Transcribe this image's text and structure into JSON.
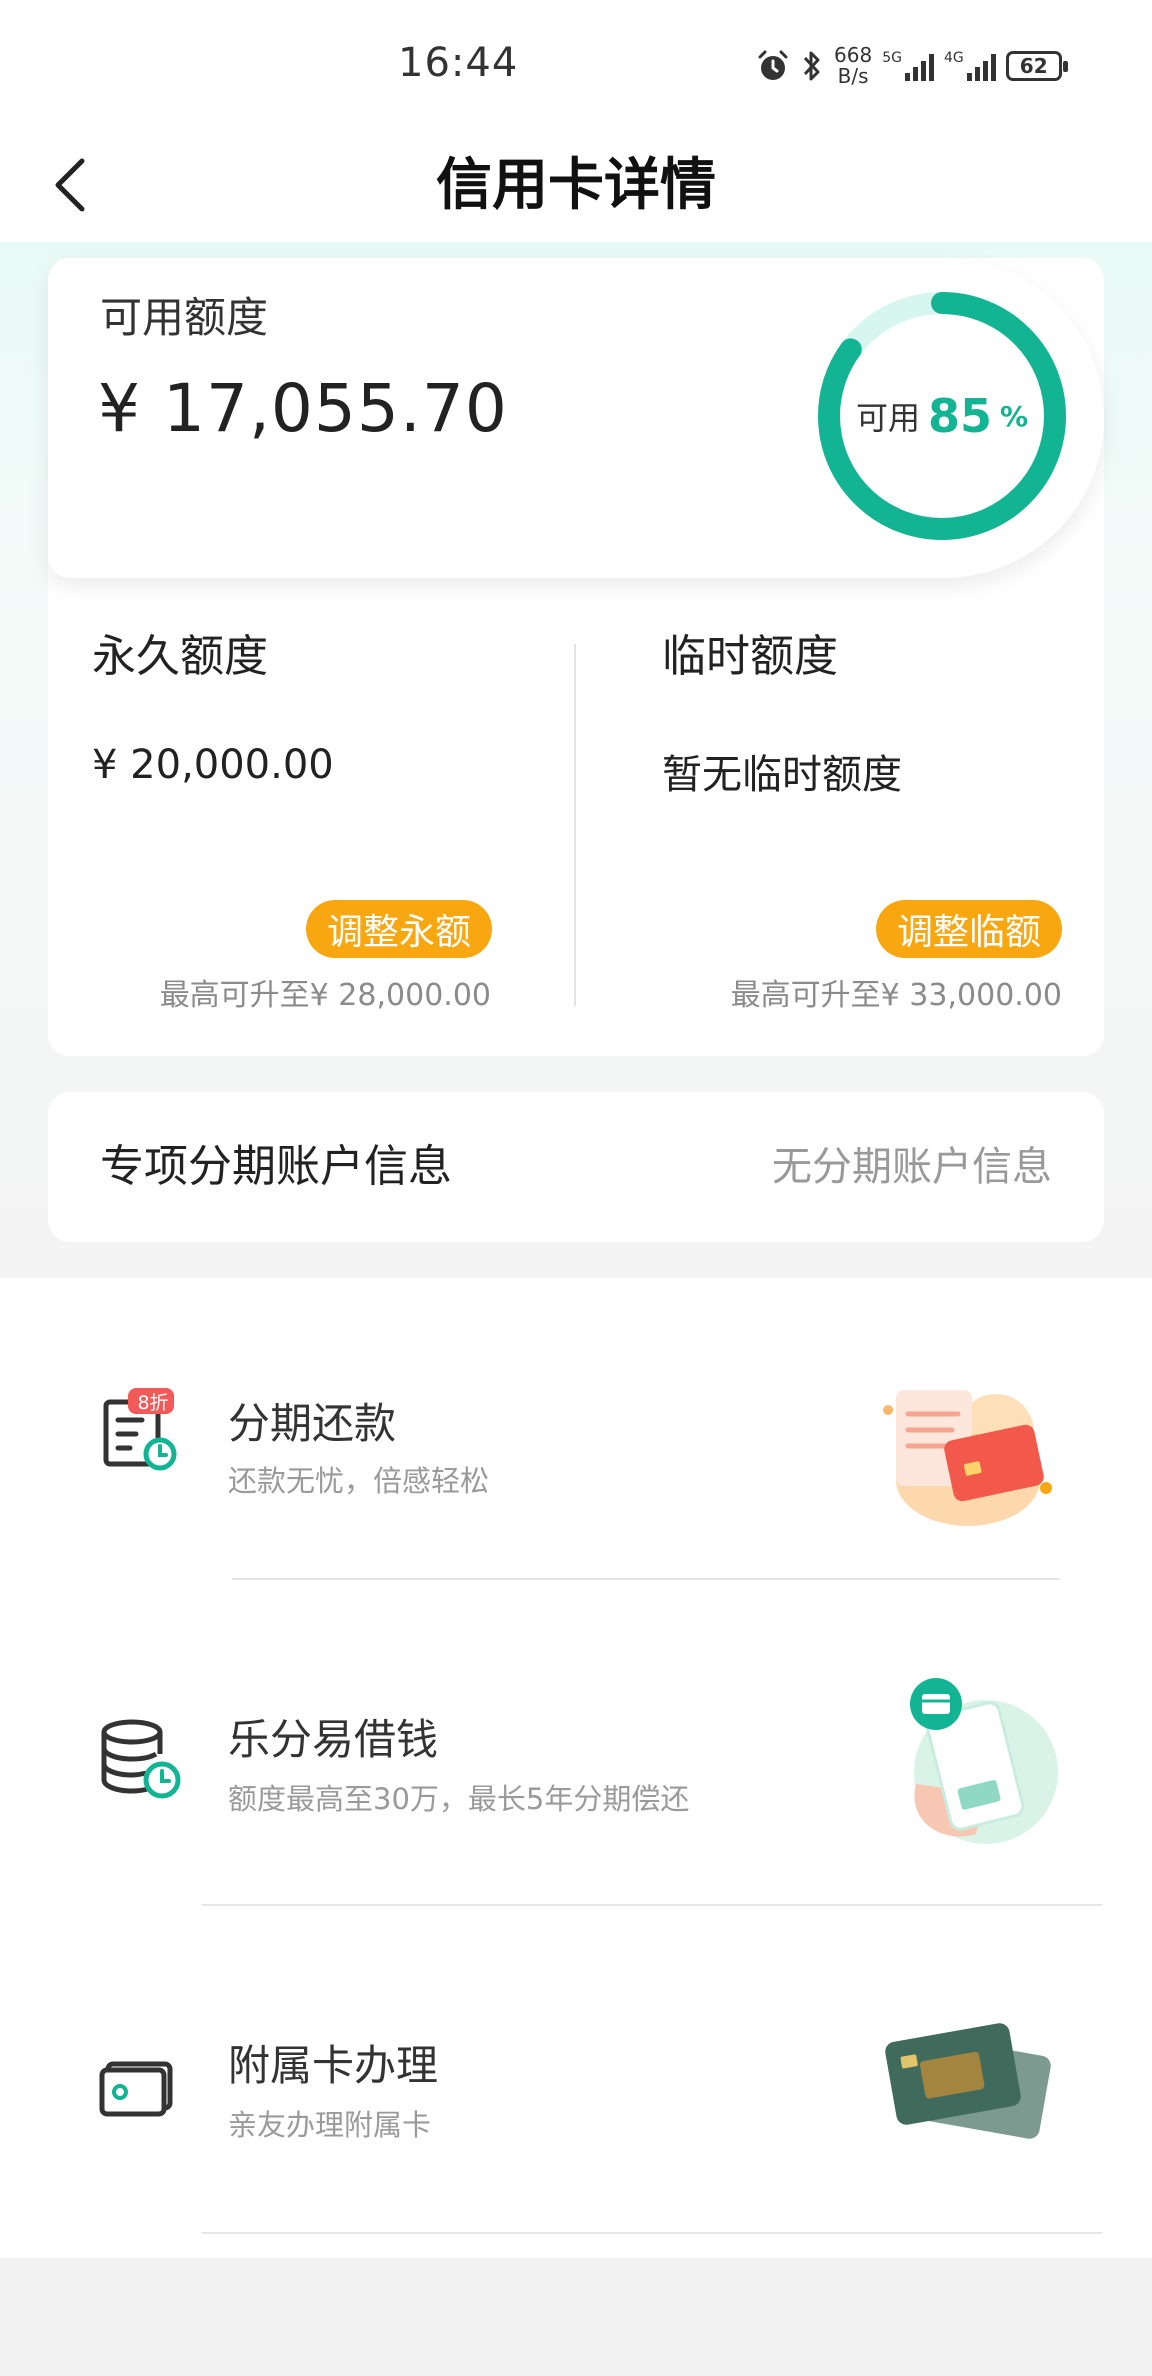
{
  "status_bar": {
    "time": "16:44",
    "net_speed_value": "668",
    "net_speed_unit": "B/s",
    "signal_1_label": "5G",
    "signal_2_label": "4G",
    "battery": "62",
    "icons": [
      "alarm-icon",
      "bluetooth-icon",
      "signal-icon",
      "battery-icon"
    ]
  },
  "header": {
    "title": "信用卡详情"
  },
  "available": {
    "label": "可用额度",
    "amount": "¥ 17,055.70",
    "ring_label": "可用",
    "ring_value": "85",
    "ring_unit": "%",
    "ring_fraction": 0.85,
    "ring_color": "#13b493",
    "ring_track_color": "#d6f6ef"
  },
  "permanent": {
    "title": "永久额度",
    "amount": "¥ 20,000.00",
    "button": "调整永额",
    "max_text": "最高可升至¥ 28,000.00"
  },
  "temporary": {
    "title": "临时额度",
    "amount": "暂无临时额度",
    "button": "调整临额",
    "max_text": "最高可升至¥ 33,000.00"
  },
  "special": {
    "title": "专项分期账户信息",
    "value": "无分期账户信息"
  },
  "services": [
    {
      "title": "分期还款",
      "desc": "还款无忧，倍感轻松",
      "badge": "8折",
      "icon": "installment-bill-icon",
      "illustration": "card-bill-illustration"
    },
    {
      "title": "乐分易借钱",
      "desc": "额度最高至30万，最长5年分期偿还",
      "icon": "coin-stack-clock-icon",
      "illustration": "phone-hand-illustration"
    },
    {
      "title": "附属卡办理",
      "desc": "亲友办理附属卡",
      "icon": "card-icon",
      "illustration": "credit-cards-illustration"
    }
  ],
  "colors": {
    "accent": "#13b493",
    "button_orange": "#f8a710",
    "badge_red": "#f25a5a"
  }
}
